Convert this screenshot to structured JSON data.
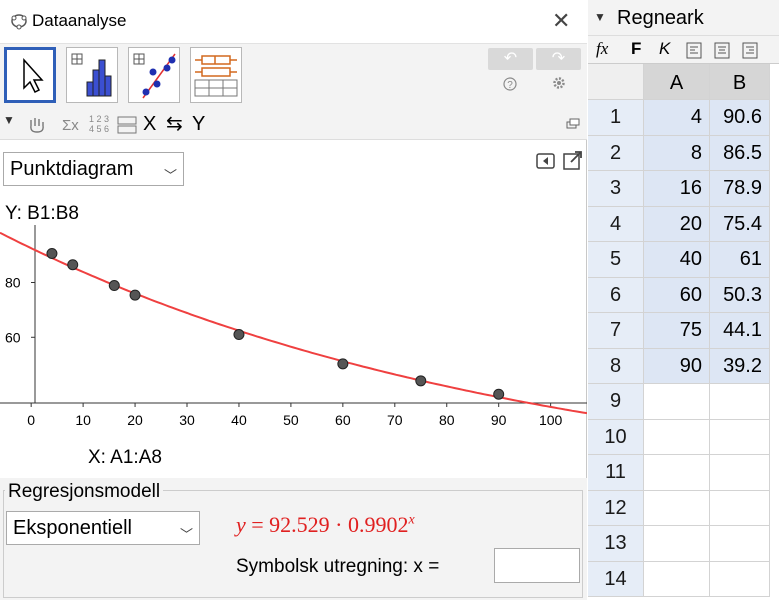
{
  "dialog": {
    "title": "Dataanalyse",
    "plot_type": "Punktdiagram"
  },
  "axes": {
    "y_source_label": "Y:  B1:B8",
    "x_source_label": "X:  A1:A8"
  },
  "options_bar": {
    "stats_symbol": "Σx",
    "swap_x": "X",
    "swap_y": "Y",
    "table_digits_top": "1 2 3",
    "table_digits_bottom": "4 5 6"
  },
  "regression": {
    "legend": "Regresjonsmodell",
    "model": "Eksponentiell",
    "formula_y": "y",
    "formula_rhs": "= 92.529 · 0.9902",
    "formula_exp": "x",
    "symbolic_label": "Symbolsk utregning:  x =",
    "symbolic_value": ""
  },
  "spreadsheet": {
    "title": "Regneark",
    "format": {
      "fx": "fx",
      "bold": "F",
      "italic": "K"
    },
    "columns": [
      "A",
      "B"
    ],
    "rows": [
      {
        "n": "1",
        "a": "4",
        "b": "90.6"
      },
      {
        "n": "2",
        "a": "8",
        "b": "86.5"
      },
      {
        "n": "3",
        "a": "16",
        "b": "78.9"
      },
      {
        "n": "4",
        "a": "20",
        "b": "75.4"
      },
      {
        "n": "5",
        "a": "40",
        "b": "61"
      },
      {
        "n": "6",
        "a": "60",
        "b": "50.3"
      },
      {
        "n": "7",
        "a": "75",
        "b": "44.1"
      },
      {
        "n": "8",
        "a": "90",
        "b": "39.2"
      },
      {
        "n": "9",
        "a": "",
        "b": ""
      },
      {
        "n": "10",
        "a": "",
        "b": ""
      },
      {
        "n": "11",
        "a": "",
        "b": ""
      },
      {
        "n": "12",
        "a": "",
        "b": ""
      },
      {
        "n": "13",
        "a": "",
        "b": ""
      },
      {
        "n": "14",
        "a": "",
        "b": ""
      }
    ]
  },
  "colors": {
    "accent": "#2f5fb8",
    "curve": "#ef4040",
    "point": "#555555",
    "cell_highlight": "#dde6f4"
  },
  "chart_data": {
    "type": "scatter",
    "x": [
      4,
      8,
      16,
      20,
      40,
      60,
      75,
      90
    ],
    "y": [
      90.6,
      86.5,
      78.9,
      75.4,
      61,
      50.3,
      44.1,
      39.2
    ],
    "x_ticks": [
      "0",
      "10",
      "20",
      "30",
      "40",
      "50",
      "60",
      "70",
      "80",
      "90",
      "100"
    ],
    "y_ticks": [
      "60",
      "80"
    ],
    "xlim": [
      -6,
      107
    ],
    "ylim": [
      36,
      101
    ],
    "fit": {
      "model": "exponential",
      "a": 92.529,
      "b": 0.9902
    },
    "grid": false
  }
}
